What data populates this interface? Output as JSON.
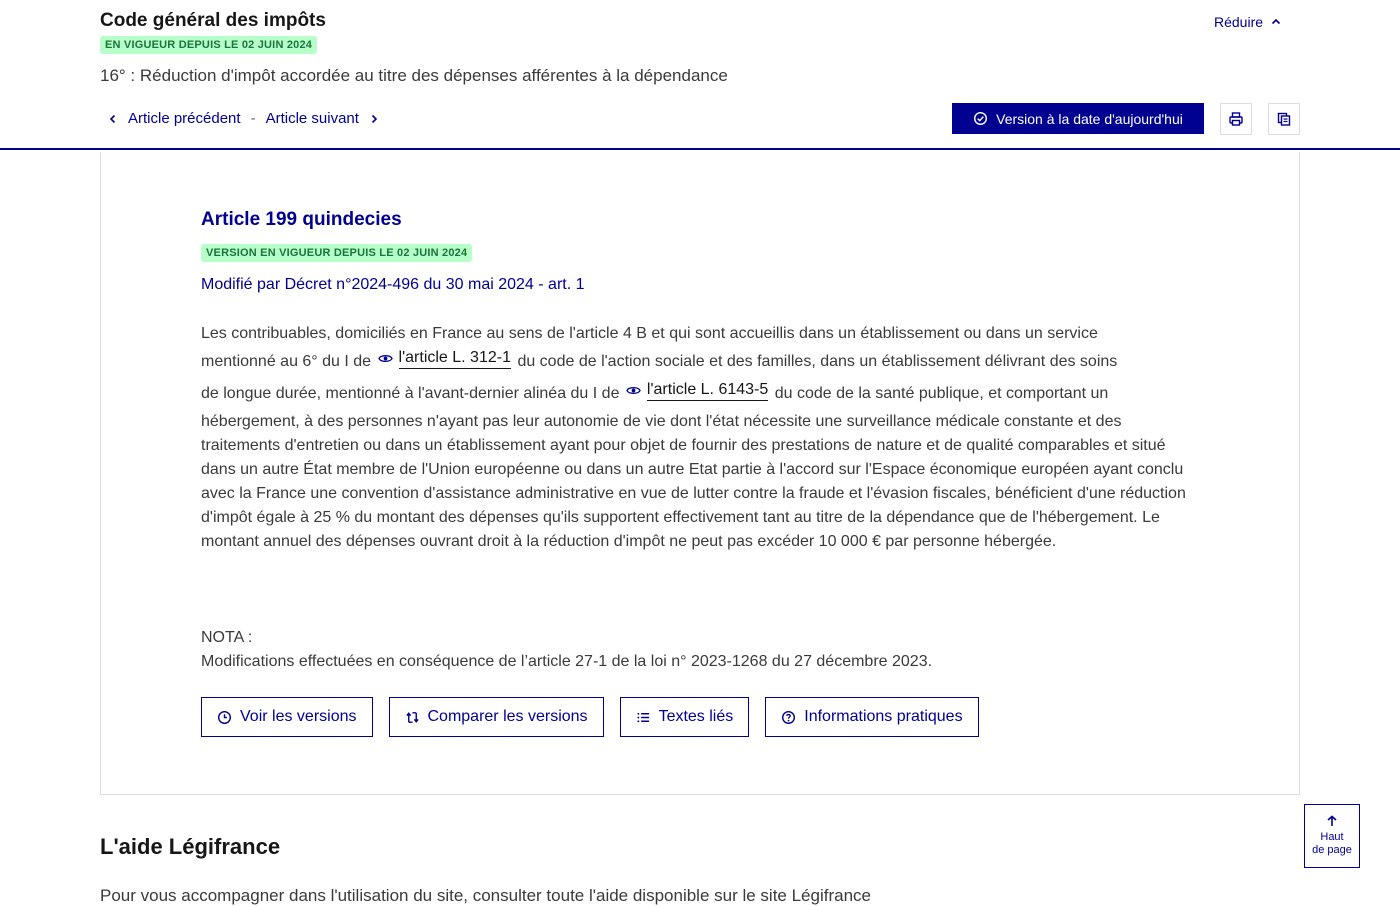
{
  "header": {
    "code_title": "Code général des impôts",
    "status_badge": "EN VIGUEUR DEPUIS LE 02 JUIN 2024",
    "reduce_label": "Réduire",
    "section_title": "16° : Réduction d'impôt accordée au titre des dépenses afférentes à la dépendance",
    "prev_label": "Article précédent",
    "separator": "-",
    "next_label": "Article suivant",
    "version_button_label": "Version à la date d'aujourd'hui",
    "print_icon": "printer-icon",
    "copy_icon": "copy-icon"
  },
  "article": {
    "title": "Article 199 quindecies",
    "version_badge": "VERSION EN VIGUEUR DEPUIS LE 02 JUIN 2024",
    "modified_by": "Modifié par Décret n°2024-496 du 30 mai 2024 - art. 1",
    "text_line1": "Les contribuables, domiciliés en France au sens de l'article 4 B et qui sont accueillis dans un établissement ou dans un service",
    "text_line2_pre": "mentionné au 6° du I de",
    "ref1": "l'article L. 312-1",
    "text_line2_post": "du code de l'action sociale et des familles, dans un établissement délivrant des soins",
    "text_line3_pre": "de longue durée, mentionné à l'avant-dernier alinéa du I de",
    "ref2": "l'article L. 6143-5",
    "text_line3_post": "du code de la santé publique, et comportant un",
    "text_rest": "hébergement, à des personnes n'ayant pas leur autonomie de vie dont l'état nécessite une surveillance médicale constante et des traitements d'entretien ou dans un établissement ayant pour objet de fournir des prestations de nature et de qualité comparables et situé dans un autre État membre de l'Union européenne ou dans un autre Etat partie à l'accord sur l'Espace économique européen ayant conclu avec la France une convention d'assistance administrative en vue de lutter contre la fraude et l'évasion fiscales, bénéficient d'une réduction d'impôt égale à 25 % du montant des dépenses qu'ils supportent effectivement tant au titre de la dépendance que de l'hébergement. Le montant annuel des dépenses ouvrant droit à la réduction d'impôt ne peut pas excéder 10 000 € par personne hébergée.",
    "nota_label": "NOTA :",
    "nota_text": "Modifications effectuées en conséquence de l’article 27-1 de la loi n° 2023-1268 du 27 décembre 2023."
  },
  "actions": {
    "versions_label": "Voir les versions",
    "compare_label": "Comparer les versions",
    "linked_label": "Textes liés",
    "info_label": "Informations pratiques"
  },
  "aide": {
    "title": "L'aide Légifrance",
    "text": "Pour vous accompagner dans l'utilisation du site, consulter toute l'aide disponible sur le site Légifrance"
  },
  "back_to_top": {
    "line1": "Haut",
    "line2": "de page"
  },
  "colors": {
    "primary": "#000091",
    "badge_bg": "#b8fec9",
    "badge_text": "#18753c"
  }
}
